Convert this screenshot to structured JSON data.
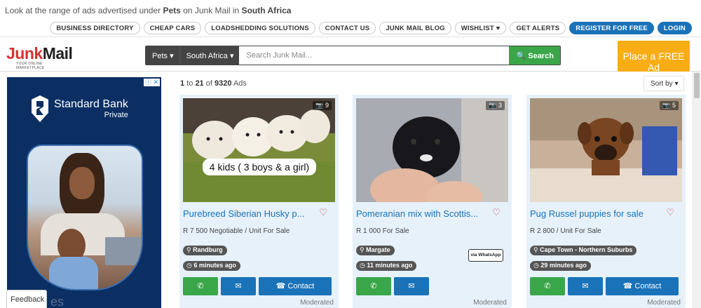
{
  "topline": {
    "prefix": "Look at the range of ads advertised under ",
    "category": "Pets",
    "middle": " on Junk Mail in ",
    "region": "South Africa"
  },
  "nav": [
    "BUSINESS DIRECTORY",
    "CHEAP CARS",
    "LOADSHEDDING SOLUTIONS",
    "CONTACT US",
    "JUNK MAIL BLOG",
    "WISHLIST ♥",
    "GET ALERTS"
  ],
  "nav_register": "REGISTER FOR FREE",
  "nav_login": "LOGIN",
  "logo": {
    "junk": "Junk",
    "mail": "Mail",
    "tagline": "YOUR ONLINE MARKETPLACE"
  },
  "search": {
    "category": "Pets ▾",
    "region": "South Africa ▾",
    "placeholder": "Search Junk Mail...",
    "button": "🔍 Search"
  },
  "place_ad": "Place a FREE Ad",
  "advert": {
    "choice": "ⓘ ✕",
    "brand": "Standard Bank",
    "sub": "Private",
    "tail": "es"
  },
  "feedback": "Feedback",
  "results": {
    "from": "1",
    "to": "21",
    "total": "9320",
    "suffix": "Ads",
    "label_to": "to",
    "label_of": "of"
  },
  "sort_label": "Sort by ▾",
  "listings": [
    {
      "title": "Purebreed Siberian Husky p...",
      "photos": "9",
      "caption": "4 kids ( 3 boys & a girl)",
      "price": "R 7 500 Negotiable / Unit For Sale",
      "location": "Randburg",
      "posted": "6 minutes ago",
      "whatsapp": false,
      "status": "Moderated"
    },
    {
      "title": "Pomeranian mix with Scottis...",
      "photos": "3",
      "caption": "",
      "price": "R 1 000 For Sale",
      "location": "Margate",
      "posted": "11 minutes ago",
      "whatsapp": true,
      "whatsapp_label": "via WhatsApp",
      "status": "Moderated"
    },
    {
      "title": "Pug Russel puppies for sale",
      "photos": "5",
      "caption": "",
      "price": "R 2 800 / Unit For Sale",
      "location": "Cape Town - Northern Suburbs",
      "posted": "29 minutes ago",
      "whatsapp": false,
      "status": "Moderated"
    }
  ],
  "buttons": {
    "contact": "Contact"
  },
  "colors": {
    "brand_red": "#d5332d",
    "link_blue": "#1a72b8",
    "green": "#3aa64a",
    "place_ad": "#f8ad14"
  }
}
